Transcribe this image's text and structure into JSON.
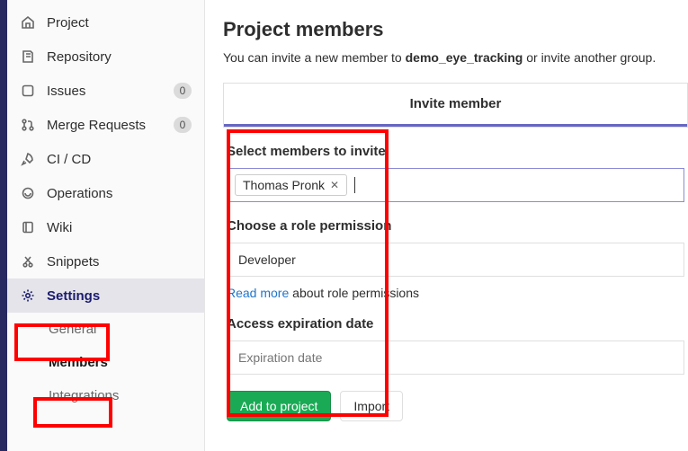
{
  "sidebar": {
    "items": [
      {
        "label": "Project",
        "icon": "home-icon"
      },
      {
        "label": "Repository",
        "icon": "repository-icon"
      },
      {
        "label": "Issues",
        "icon": "issues-icon",
        "badge": "0"
      },
      {
        "label": "Merge Requests",
        "icon": "merge-request-icon",
        "badge": "0"
      },
      {
        "label": "CI / CD",
        "icon": "rocket-icon"
      },
      {
        "label": "Operations",
        "icon": "operations-icon"
      },
      {
        "label": "Wiki",
        "icon": "book-icon"
      },
      {
        "label": "Snippets",
        "icon": "snippets-icon"
      },
      {
        "label": "Settings",
        "icon": "gear-icon"
      }
    ],
    "settings_sub": [
      {
        "label": "General"
      },
      {
        "label": "Members"
      },
      {
        "label": "Integrations"
      }
    ]
  },
  "main": {
    "title": "Project members",
    "intro_pre": "You can invite a new member to ",
    "intro_project": "demo_eye_tracking",
    "intro_post": " or invite another group.",
    "tab_label": "Invite member",
    "select_label": "Select members to invite",
    "member_token": "Thomas Pronk",
    "role_label": "Choose a role permission",
    "role_value": "Developer",
    "readmore_link": "Read more",
    "readmore_text": " about role permissions",
    "exp_label": "Access expiration date",
    "exp_placeholder": "Expiration date",
    "btn_add": "Add to project",
    "btn_import": "Import"
  }
}
